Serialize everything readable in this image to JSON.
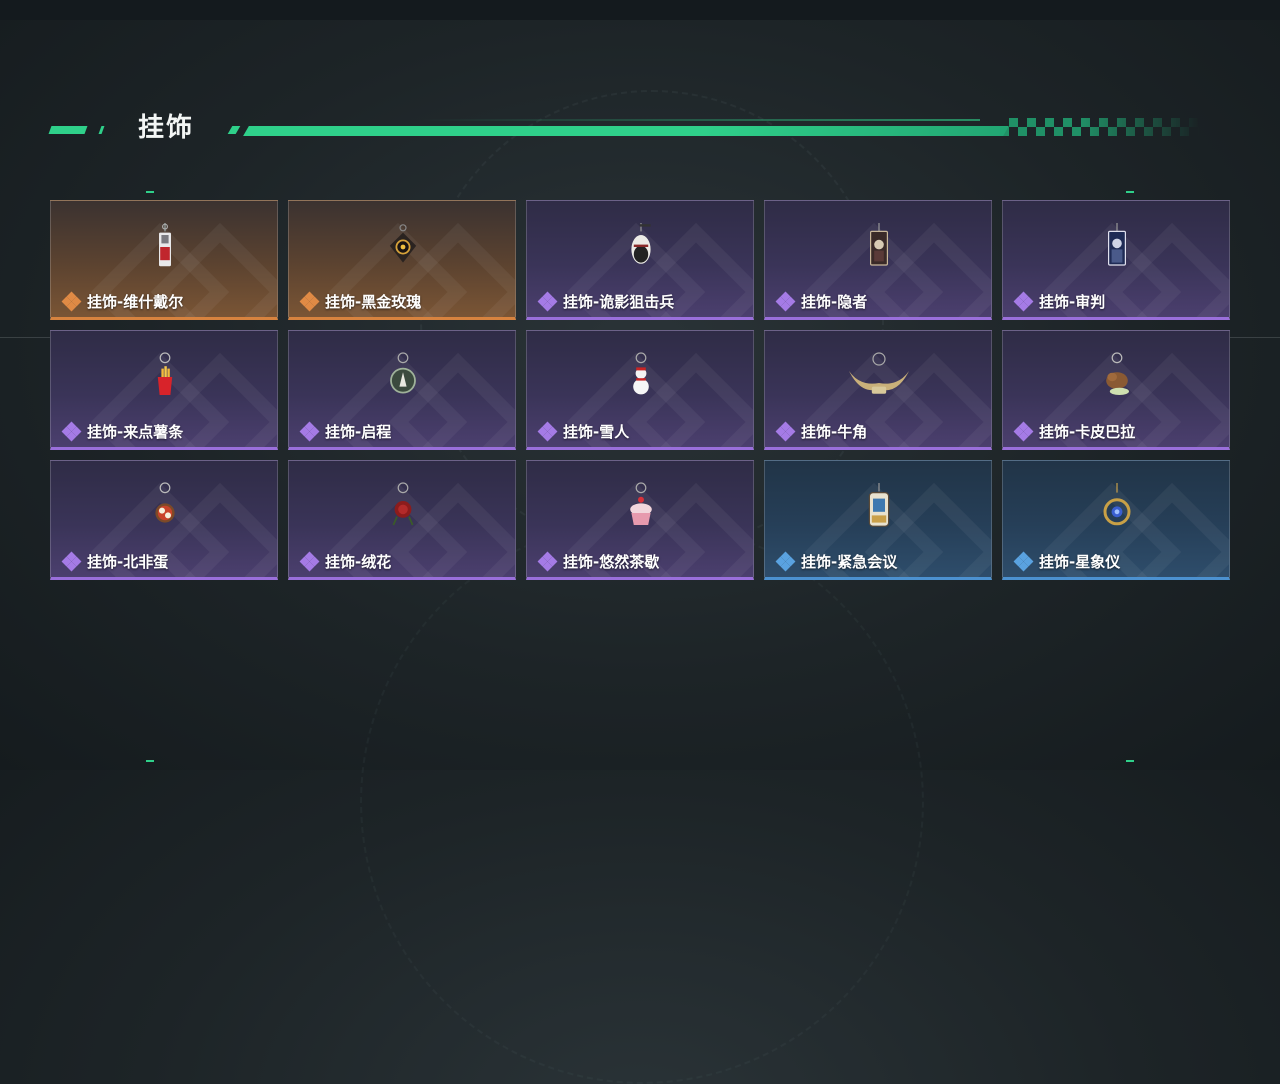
{
  "page": {
    "title": "挂饰"
  },
  "colors": {
    "accent": "#2fd08a",
    "rarity_orange": "#d7833f",
    "rarity_purple": "#9a6fdb",
    "rarity_blue": "#4c91d0"
  },
  "items": [
    {
      "name": "挂饰-维什戴尔",
      "rarity": "orange",
      "icon": "tag-keychain-icon"
    },
    {
      "name": "挂饰-黑金玫瑰",
      "rarity": "orange",
      "icon": "black-rose-keychain-icon"
    },
    {
      "name": "挂饰-诡影狙击兵",
      "rarity": "purple",
      "icon": "sniper-figure-keychain-icon"
    },
    {
      "name": "挂饰-隐者",
      "rarity": "purple",
      "icon": "hermit-card-keychain-icon"
    },
    {
      "name": "挂饰-审判",
      "rarity": "purple",
      "icon": "judgement-card-keychain-icon"
    },
    {
      "name": "挂饰-来点薯条",
      "rarity": "purple",
      "icon": "fries-keychain-icon"
    },
    {
      "name": "挂饰-启程",
      "rarity": "purple",
      "icon": "medal-keychain-icon"
    },
    {
      "name": "挂饰-雪人",
      "rarity": "purple",
      "icon": "snowman-keychain-icon"
    },
    {
      "name": "挂饰-牛角",
      "rarity": "purple",
      "icon": "horns-keychain-icon"
    },
    {
      "name": "挂饰-卡皮巴拉",
      "rarity": "purple",
      "icon": "capybara-keychain-icon"
    },
    {
      "name": "挂饰-北非蛋",
      "rarity": "purple",
      "icon": "shakshuka-keychain-icon"
    },
    {
      "name": "挂饰-绒花",
      "rarity": "purple",
      "icon": "velvet-flower-keychain-icon"
    },
    {
      "name": "挂饰-悠然茶歇",
      "rarity": "purple",
      "icon": "cupcake-keychain-icon"
    },
    {
      "name": "挂饰-紧急会议",
      "rarity": "blue",
      "icon": "meeting-badge-keychain-icon"
    },
    {
      "name": "挂饰-星象仪",
      "rarity": "blue",
      "icon": "astrolabe-keychain-icon"
    }
  ]
}
